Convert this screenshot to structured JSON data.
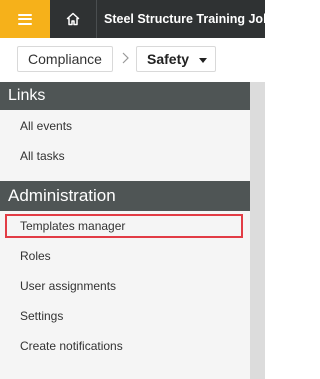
{
  "topbar": {
    "job_title": "Steel Structure Training Job |"
  },
  "breadcrumb": {
    "first": "Compliance",
    "current": "Safety"
  },
  "sections": {
    "links": {
      "title": "Links",
      "items": [
        "All events",
        "All tasks"
      ]
    },
    "administration": {
      "title": "Administration",
      "items": [
        "Templates manager",
        "Roles",
        "User assignments",
        "Settings",
        "Create notifications"
      ]
    }
  },
  "colors": {
    "accent": "#f6b11a",
    "topbar": "#2f3233",
    "section_header": "#4f5555",
    "highlight": "#e23c45"
  }
}
